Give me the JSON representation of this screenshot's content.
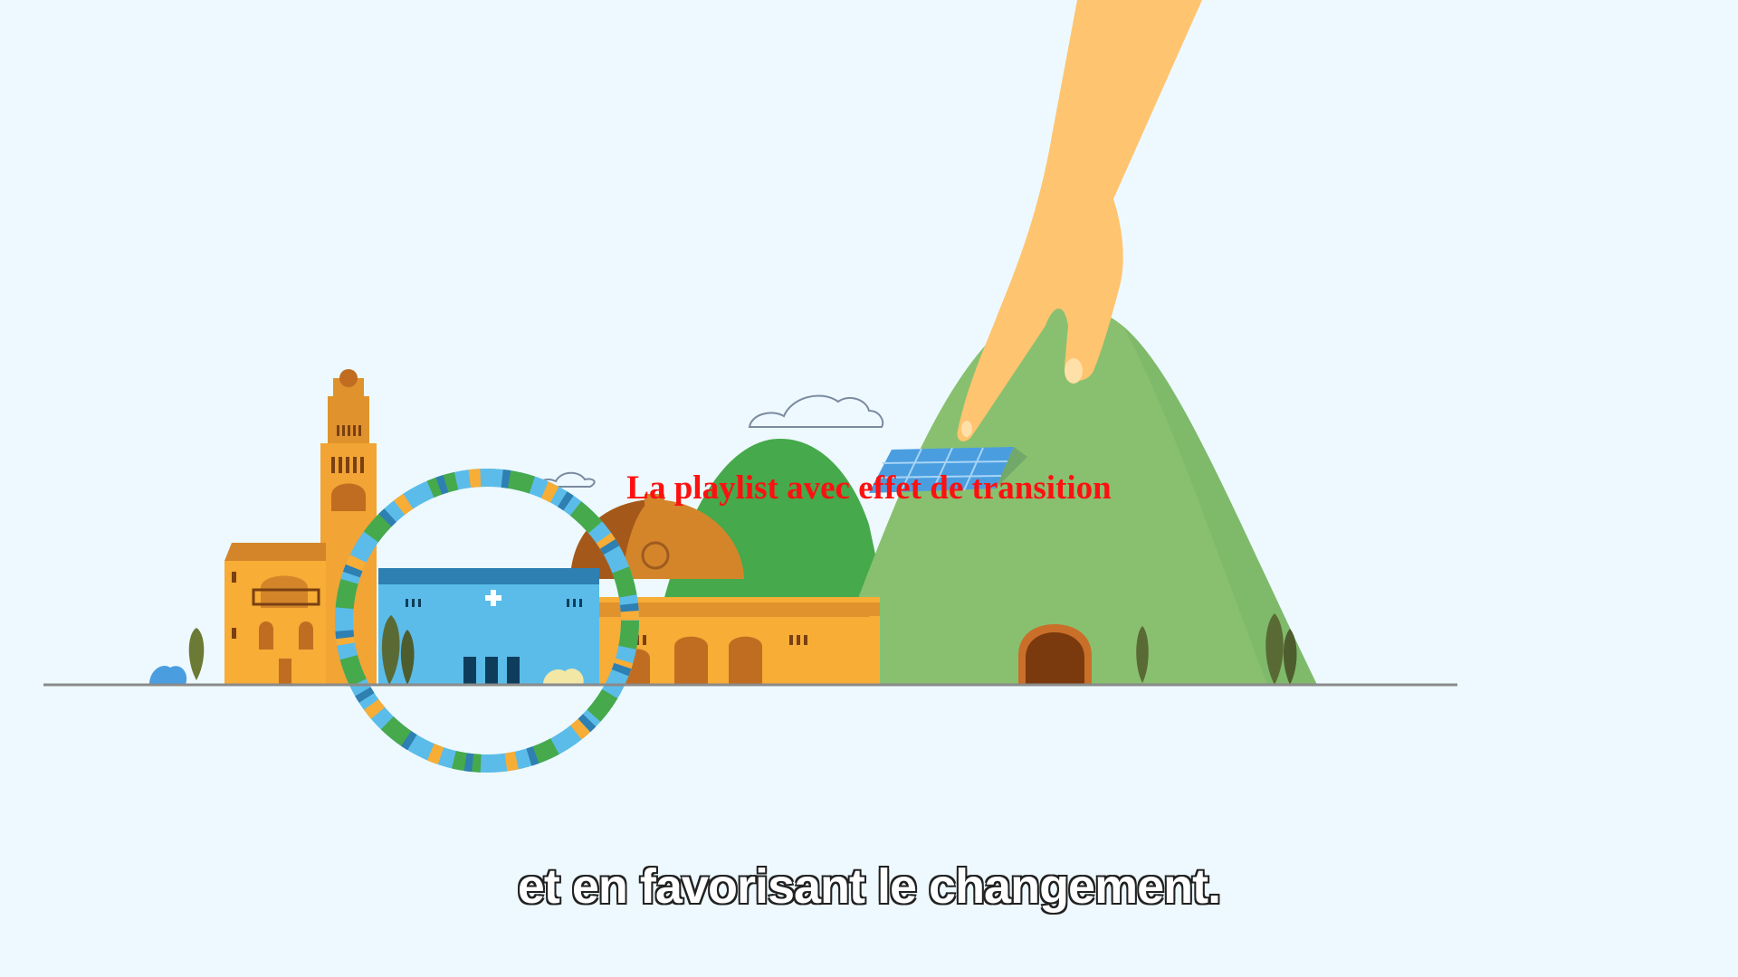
{
  "video": {
    "overlay_title": "La playlist avec effet de transition",
    "subtitle": "et en favorisant le changement."
  },
  "scene": {
    "background_color": "#edf9fe",
    "elements": [
      "tower",
      "domed-building",
      "blue-hospital-building",
      "mosaic-ring",
      "green-hills",
      "hand",
      "solar-panel",
      "tunnel",
      "cypress-trees",
      "clouds",
      "ground-line"
    ]
  },
  "colors": {
    "title_red": "#ff1010",
    "hill_light": "#88c070",
    "hill_dark": "#46a94b",
    "building_orange": "#f7ad36",
    "building_dark_orange": "#e0922c",
    "blue_building": "#5bbce9",
    "skin": "#ffc46f"
  }
}
